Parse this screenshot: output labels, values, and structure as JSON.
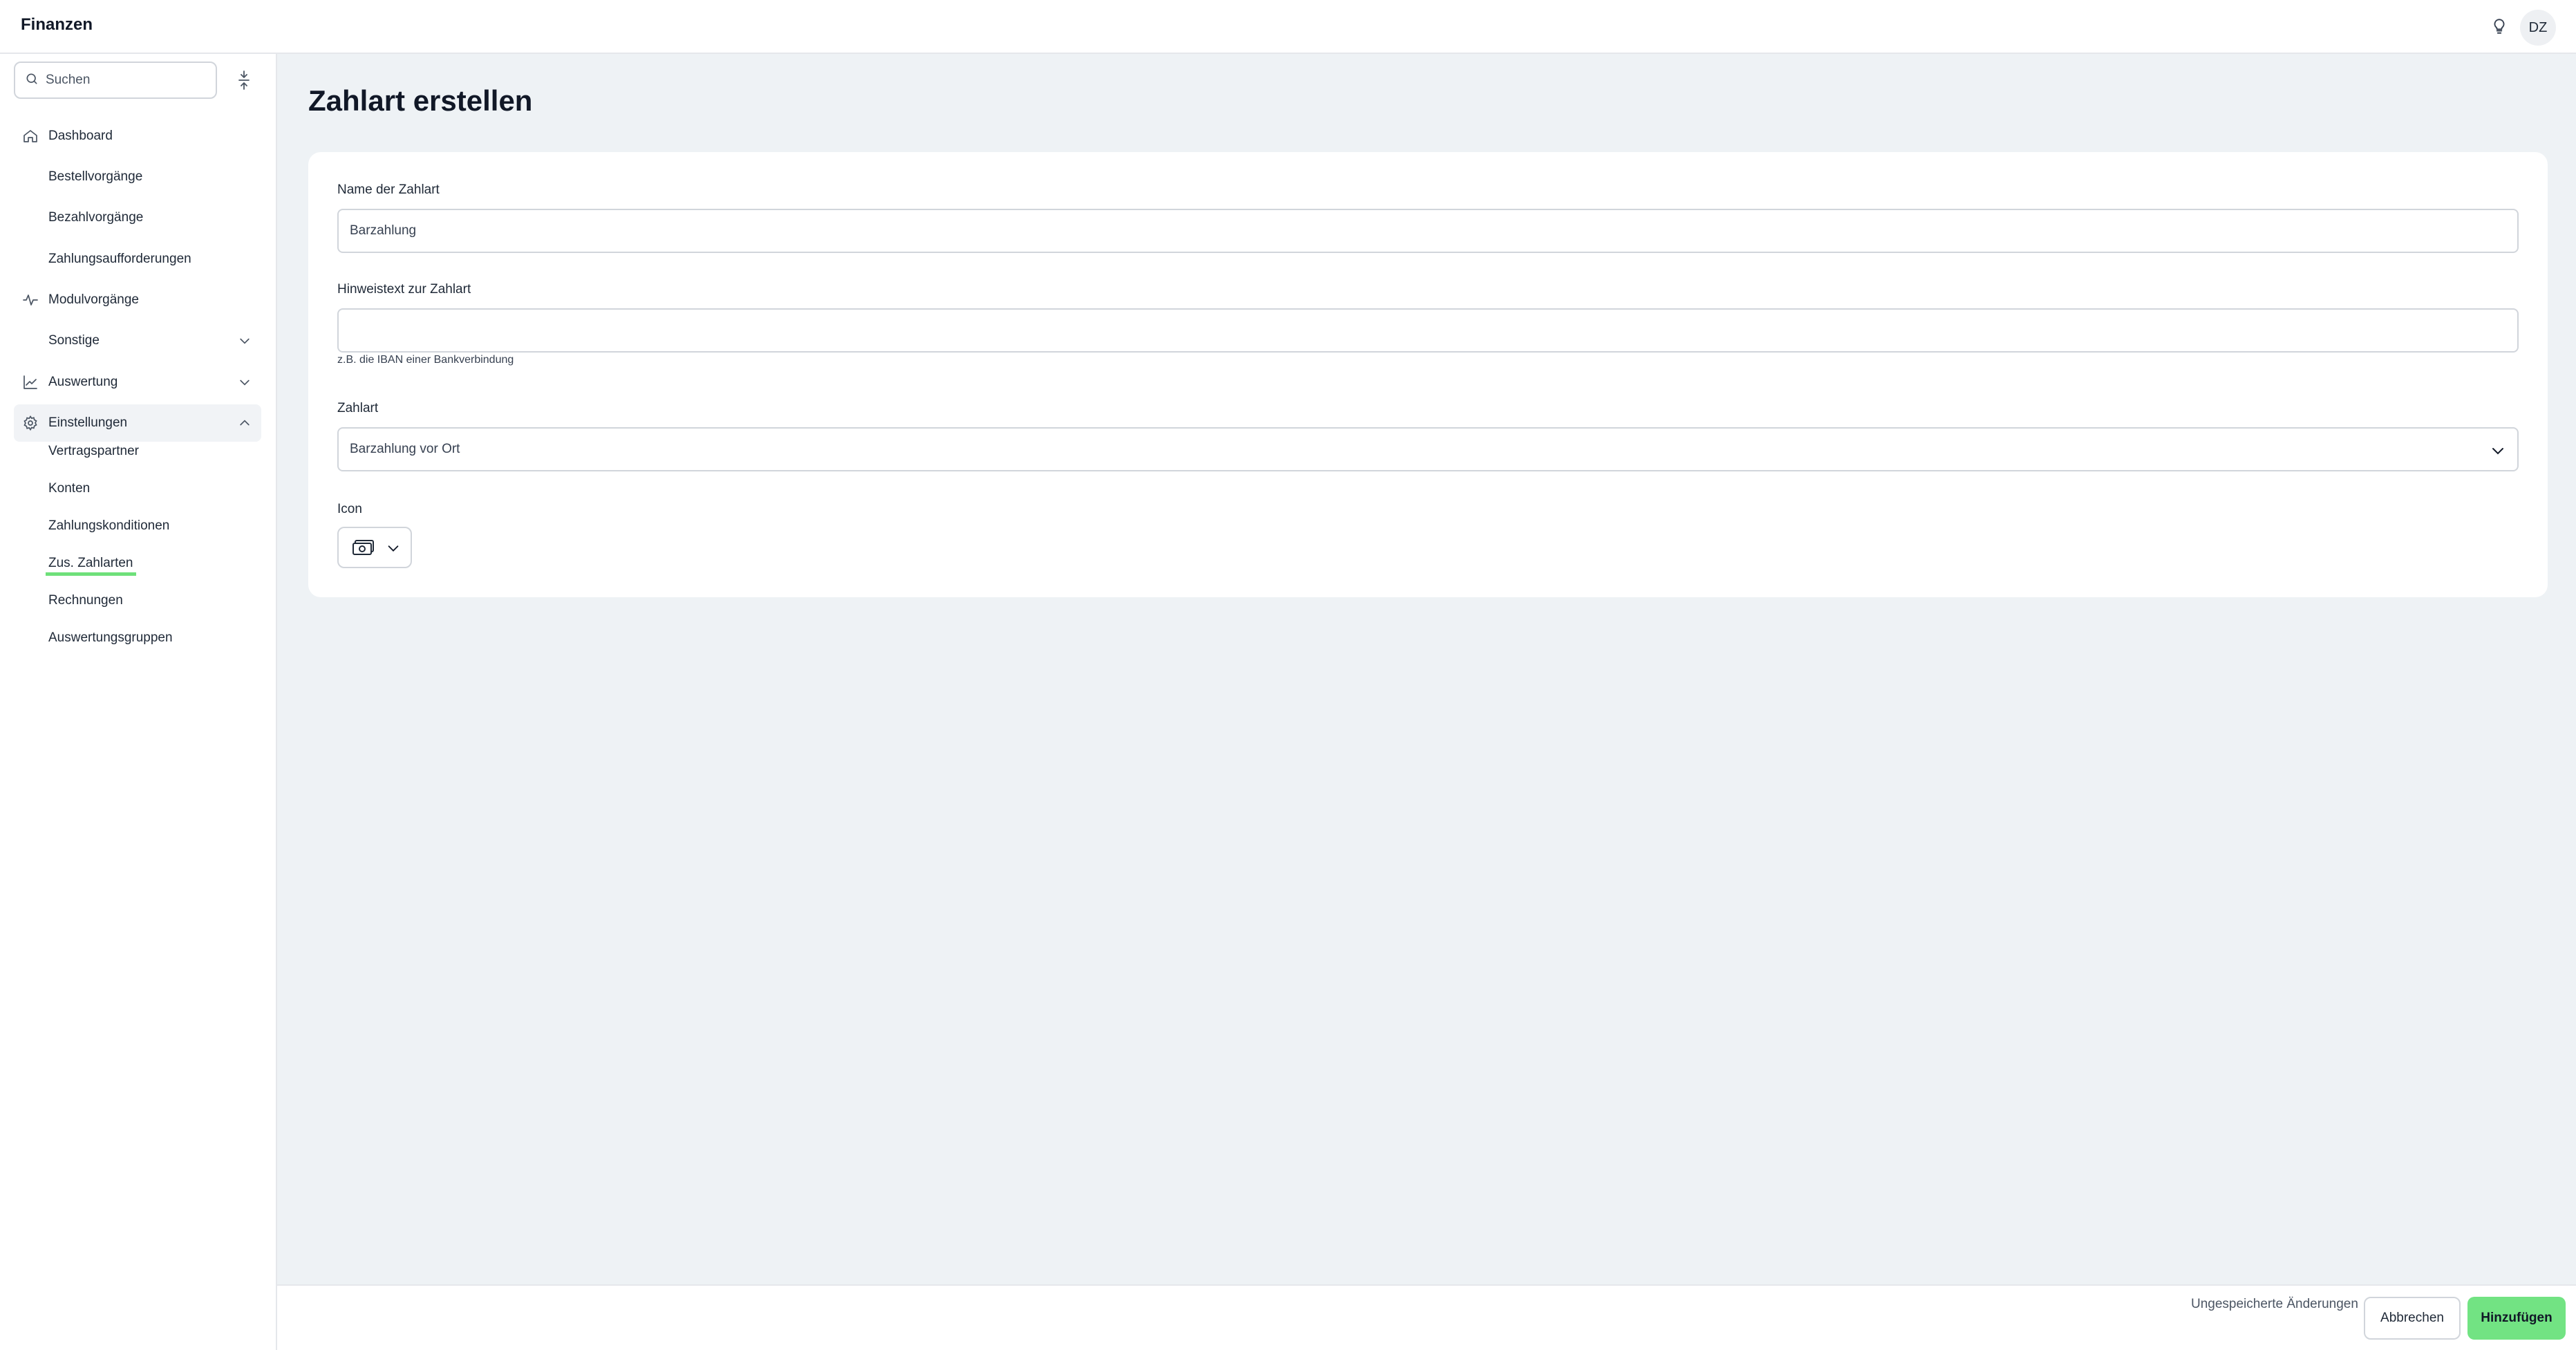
{
  "app": {
    "title": "Finanzen"
  },
  "header": {
    "avatar_initials": "DZ",
    "icons": [
      "lightbulb-icon"
    ]
  },
  "sidebar": {
    "search_placeholder": "Suchen",
    "items": [
      {
        "label": "Dashboard",
        "icon": "home-icon"
      },
      {
        "label": "Bestellvorgänge"
      },
      {
        "label": "Bezahlvorgänge"
      },
      {
        "label": "Zahlungsaufforderungen"
      },
      {
        "label": "Modulvorgänge",
        "icon": "activity-icon"
      },
      {
        "label": "Sonstige",
        "expandable": true
      },
      {
        "label": "Auswertung",
        "icon": "chart-icon",
        "expandable": true
      },
      {
        "label": "Einstellungen",
        "icon": "gear-icon",
        "expanded": true
      }
    ],
    "settings_sub": [
      "Vertragspartner",
      "Konten",
      "Zahlungskonditionen",
      "Zus. Zahlarten",
      "Rechnungen",
      "Auswertungsgruppen"
    ],
    "active_sub": "Zus. Zahlarten"
  },
  "main": {
    "title": "Zahlart erstellen",
    "form": {
      "name_label": "Name der Zahlart",
      "name_value": "Barzahlung",
      "hint_label": "Hinweistext zur Zahlart",
      "hint_value": "",
      "hint_help": "z.B. die IBAN einer Bankverbindung",
      "type_label": "Zahlart",
      "type_value": "Barzahlung vor Ort",
      "icon_label": "Icon",
      "icon_value": "cash-icon"
    }
  },
  "footer": {
    "unsaved_text": "Ungespeicherte Änderungen",
    "cancel_label": "Abbrechen",
    "add_label": "Hinzufügen"
  },
  "colors": {
    "accent": "#72e383",
    "background": "#eef2f5",
    "active_underline": "#6ee07a"
  }
}
